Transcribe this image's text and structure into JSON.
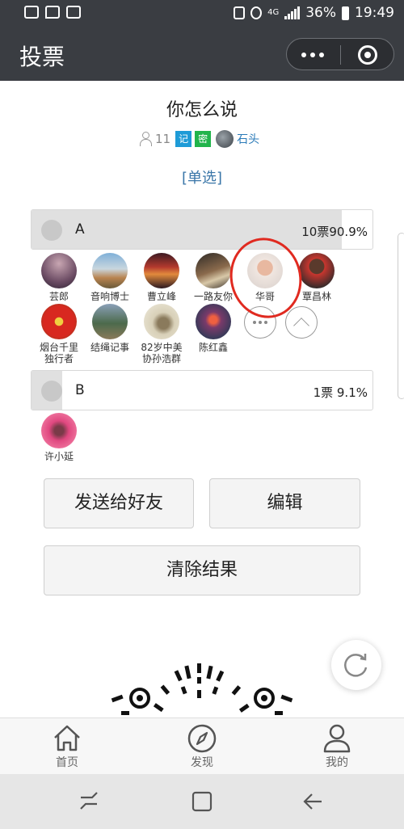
{
  "status_bar": {
    "network": "4G",
    "battery": "36%",
    "time": "19:49"
  },
  "navbar": {
    "title": "投票",
    "icons": [
      "more-icon",
      "close-mini-program-icon"
    ]
  },
  "poll": {
    "title": "你怎么说",
    "participant_count": "11",
    "badge_record": "记",
    "badge_secret": "密",
    "owner_name": "石头",
    "type": "[单选]"
  },
  "options": [
    {
      "label": "A",
      "result": "10票90.9%",
      "fraction": 0.909,
      "voters": [
        "芸郎",
        "音响博士",
        "曹立峰",
        "一路友你",
        "华哥",
        "覃昌林",
        "烟台千里\n独行者",
        "结绳记事",
        "82岁中美\n协孙浩群",
        "陈红鑫"
      ]
    },
    {
      "label": "B",
      "result": "1票  9.1%",
      "fraction": 0.091,
      "voters": [
        "许小延"
      ]
    }
  ],
  "buttons": {
    "send": "发送给好友",
    "edit": "编辑",
    "clear": "清除结果"
  },
  "tabbar": [
    {
      "label": "首页",
      "icon": "home-icon"
    },
    {
      "label": "发现",
      "icon": "compass-icon"
    },
    {
      "label": "我的",
      "icon": "person-icon"
    }
  ],
  "colors": {
    "bar": "#3a3d42",
    "accent_blue": "#1e9bd7",
    "accent_green": "#21b44b",
    "link": "#2a7ab8",
    "annotation": "#e02a20"
  }
}
